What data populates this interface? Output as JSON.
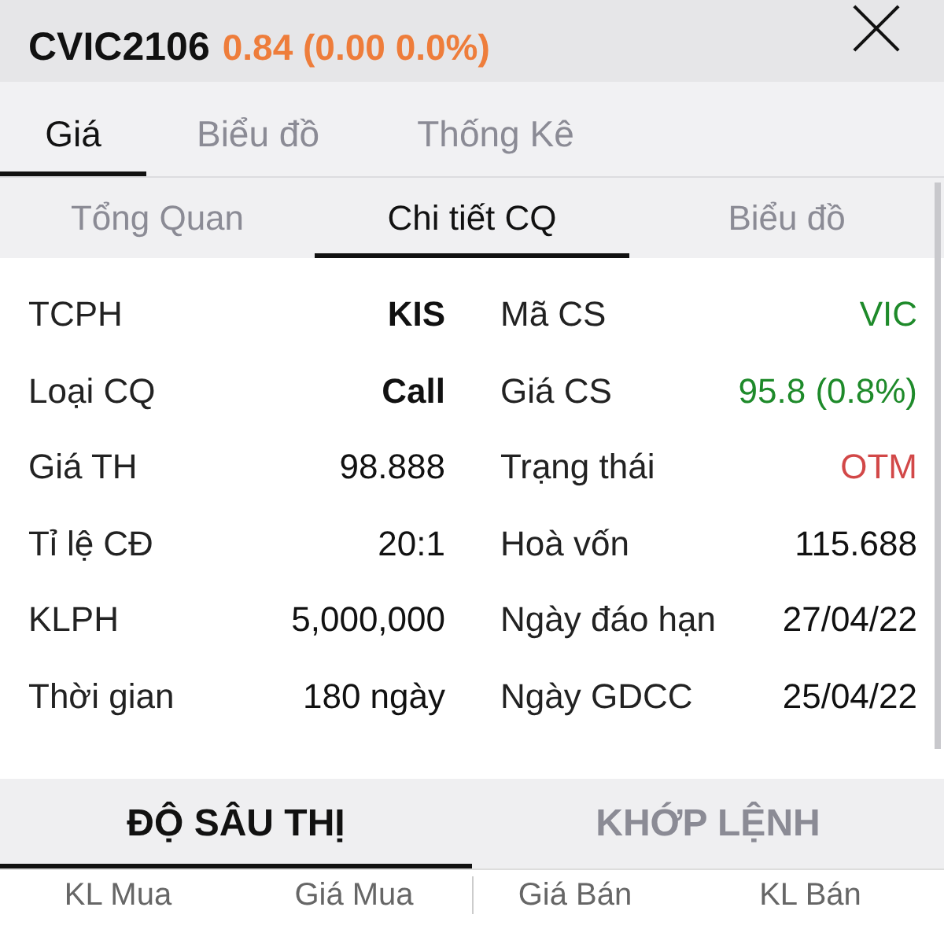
{
  "header": {
    "symbol": "CVIC2106",
    "price": "0.84 (0.00 0.0%)"
  },
  "tabs": [
    {
      "label": "Giá",
      "selected": true
    },
    {
      "label": "Biểu đồ",
      "selected": false
    },
    {
      "label": "Thống Kê",
      "selected": false
    }
  ],
  "sub_tabs": [
    {
      "label": "Tổng Quan",
      "selected": false
    },
    {
      "label": "Chi tiết CQ",
      "selected": true
    },
    {
      "label": "Biểu đồ",
      "selected": false
    }
  ],
  "details": [
    {
      "left": {
        "label": "TCPH",
        "value": "KIS",
        "bold": true
      },
      "right": {
        "label": "Mã CS",
        "value": "VIC",
        "color": "#1e8a2a"
      }
    },
    {
      "left": {
        "label": "Loại CQ",
        "value": "Call",
        "bold": true
      },
      "right": {
        "label": "Giá CS",
        "value": "95.8 (0.8%)",
        "color": "#1e8a2a"
      }
    },
    {
      "left": {
        "label": "Giá TH",
        "value": "98.888",
        "bold": false
      },
      "right": {
        "label": "Trạng thái",
        "value": "OTM",
        "color": "#d24848"
      }
    },
    {
      "left": {
        "label": "Tỉ lệ CĐ",
        "value": "20:1",
        "bold": false
      },
      "right": {
        "label": "Hoà vốn",
        "value": "115.688",
        "color": "#111111"
      }
    },
    {
      "left": {
        "label": "KLPH",
        "value": "5,000,000",
        "bold": false
      },
      "right": {
        "label": "Ngày đáo hạn",
        "value": "27/04/22",
        "color": "#111111"
      }
    },
    {
      "left": {
        "label": "Thời gian",
        "value": "180 ngày",
        "bold": false
      },
      "right": {
        "label": "Ngày GDCC",
        "value": "25/04/22",
        "color": "#111111"
      }
    }
  ],
  "market_tabs": [
    {
      "label": "ĐỘ SÂU THỊ",
      "selected": true
    },
    {
      "label": "KHỚP LỆNH",
      "selected": false
    }
  ],
  "order_book_columns": [
    "KL Mua",
    "Giá Mua",
    "Giá Bán",
    "KL Bán"
  ]
}
